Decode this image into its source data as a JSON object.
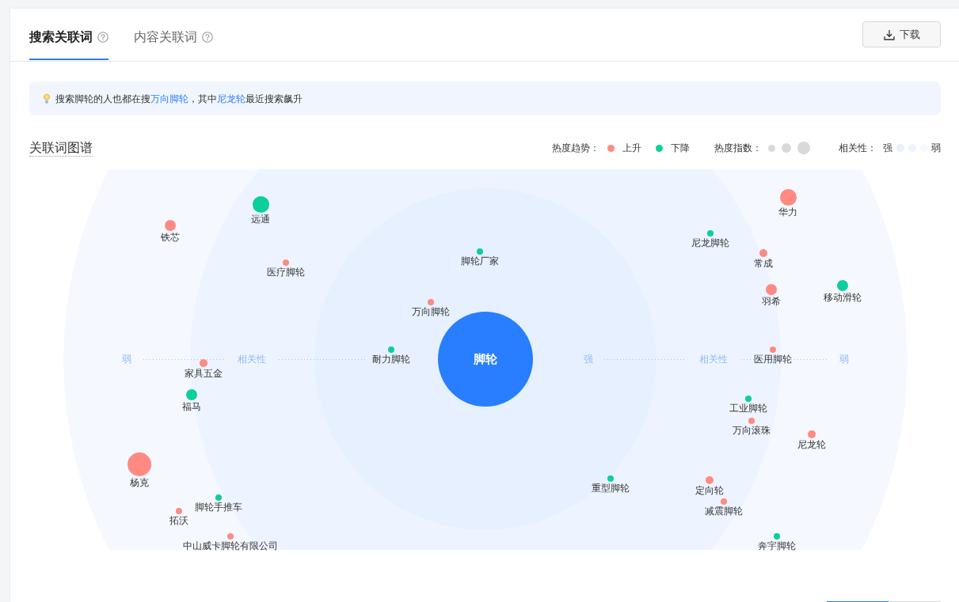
{
  "tabs": [
    {
      "label": "搜索关联词",
      "selected": true
    },
    {
      "label": "内容关联词",
      "selected": false
    }
  ],
  "download_button": {
    "label": "下载"
  },
  "tip": {
    "segments": [
      {
        "kind": "text",
        "text": "搜索脚轮的人也都在搜"
      },
      {
        "kind": "link",
        "text": "万向脚轮"
      },
      {
        "kind": "text",
        "text": "，其中"
      },
      {
        "kind": "link",
        "text": "尼龙轮"
      },
      {
        "kind": "text",
        "text": "最近搜索飙升"
      }
    ]
  },
  "graph": {
    "title": "关联词图谱",
    "legend": {
      "trend_label": "热度趋势：",
      "trends": [
        {
          "color": "#ff8a82",
          "label": "上升"
        },
        {
          "color": "#0ccf9d",
          "label": "下降"
        }
      ],
      "heat_label": "热度指数：",
      "relevance_label": "相关性：",
      "relevance_strong": "强",
      "relevance_weak": "弱"
    },
    "center": {
      "label": "脚轮"
    },
    "axis": {
      "left": [
        "弱",
        "相关性"
      ],
      "right": [
        "强",
        "相关性",
        "弱"
      ]
    },
    "nodes": [
      {
        "label": "华力",
        "color": "#ff8a82",
        "kind": "large"
      },
      {
        "label": "远通",
        "color": "#0ccf9d",
        "kind": "large"
      },
      {
        "label": "铁芯",
        "color": "#ff8a82",
        "kind": "medium"
      },
      {
        "label": "尼龙脚轮",
        "color": "#0ccf9d",
        "kind": "tiny"
      },
      {
        "label": "脚轮厂家",
        "color": "#0ccf9d",
        "kind": "tiny"
      },
      {
        "label": "常成",
        "color": "#ff8a82",
        "kind": "small"
      },
      {
        "label": "医疗脚轮",
        "color": "#ff8a82",
        "kind": "tiny"
      },
      {
        "label": "移动滑轮",
        "color": "#0ccf9d",
        "kind": "medium"
      },
      {
        "label": "羽希",
        "color": "#ff8a82",
        "kind": "medium"
      },
      {
        "label": "万向脚轮",
        "color": "#ff8a82",
        "kind": "tiny"
      },
      {
        "label": "耐力脚轮",
        "color": "#0ccf9d",
        "kind": "tiny"
      },
      {
        "label": "医用脚轮",
        "color": "#ff8a82",
        "kind": "tiny"
      },
      {
        "label": "家具五金",
        "color": "#ff8a82",
        "kind": "small"
      },
      {
        "label": "福马",
        "color": "#0ccf9d",
        "kind": "medium"
      },
      {
        "label": "工业脚轮",
        "color": "#0ccf9d",
        "kind": "tiny"
      },
      {
        "label": "万向滚珠",
        "color": "#ff8a82",
        "kind": "tiny"
      },
      {
        "label": "尼龙轮",
        "color": "#ff8a82",
        "kind": "small"
      },
      {
        "label": "杨克",
        "color": "#ff8a82",
        "kind": "huge"
      },
      {
        "label": "重型脚轮",
        "color": "#0ccf9d",
        "kind": "tiny"
      },
      {
        "label": "定向轮",
        "color": "#ff8a82",
        "kind": "small"
      },
      {
        "label": "脚轮手推车",
        "color": "#0ccf9d",
        "kind": "tiny"
      },
      {
        "label": "减震脚轮",
        "color": "#ff8a82",
        "kind": "tiny"
      },
      {
        "label": "拓沃",
        "color": "#ff8a82",
        "kind": "tiny"
      },
      {
        "label": "中山威卡脚轮有限公司",
        "color": "#ff8a82",
        "kind": "tiny"
      },
      {
        "label": "奔宇脚轮",
        "color": "#0ccf9d",
        "kind": "tiny"
      }
    ]
  }
}
